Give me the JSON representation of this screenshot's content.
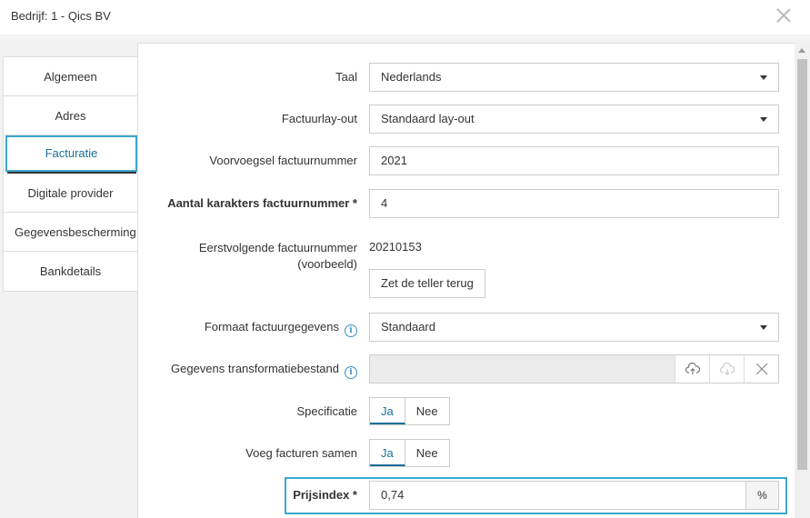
{
  "window": {
    "title": "Bedrijf: 1 - Qics BV"
  },
  "tabs": [
    {
      "label": "Algemeen"
    },
    {
      "label": "Adres"
    },
    {
      "label": "Facturatie"
    },
    {
      "label": "Digitale provider"
    },
    {
      "label": "Gegevensbescherming"
    },
    {
      "label": "Bankdetails"
    }
  ],
  "active_tab": "Facturatie",
  "form": {
    "taal": {
      "label": "Taal",
      "value": "Nederlands"
    },
    "factuurlayout": {
      "label": "Factuurlay-out",
      "value": "Standaard lay-out"
    },
    "voorvoegsel": {
      "label": "Voorvoegsel factuurnummer",
      "value": "2021"
    },
    "aantal_karakters": {
      "label": "Aantal karakters factuurnummer *",
      "value": "4"
    },
    "eerstvolgende": {
      "label_line1": "Eerstvolgende factuurnummer",
      "label_line2": "(voorbeeld)",
      "value": "20210153",
      "button": "Zet de teller terug"
    },
    "formaat": {
      "label": "Formaat factuurgegevens",
      "value": "Standaard"
    },
    "transformatie": {
      "label": "Gegevens transformatiebestand",
      "value": ""
    },
    "specificatie": {
      "label": "Specificatie",
      "yes": "Ja",
      "no": "Nee",
      "selected": "Ja"
    },
    "voeg_samen": {
      "label": "Voeg facturen samen",
      "yes": "Ja",
      "no": "Nee",
      "selected": "Ja"
    },
    "prijsindex": {
      "label": "Prijsindex *",
      "value": "0,74",
      "suffix": "%"
    }
  },
  "icons": {
    "info": "info-icon",
    "upload": "cloud-upload-icon",
    "download": "cloud-download-icon",
    "clear": "close-icon",
    "window_close": "close-icon",
    "dropdown": "chevron-down-icon"
  },
  "colors": {
    "accent": "#3aa8cc",
    "active_text": "#1a6e99"
  }
}
